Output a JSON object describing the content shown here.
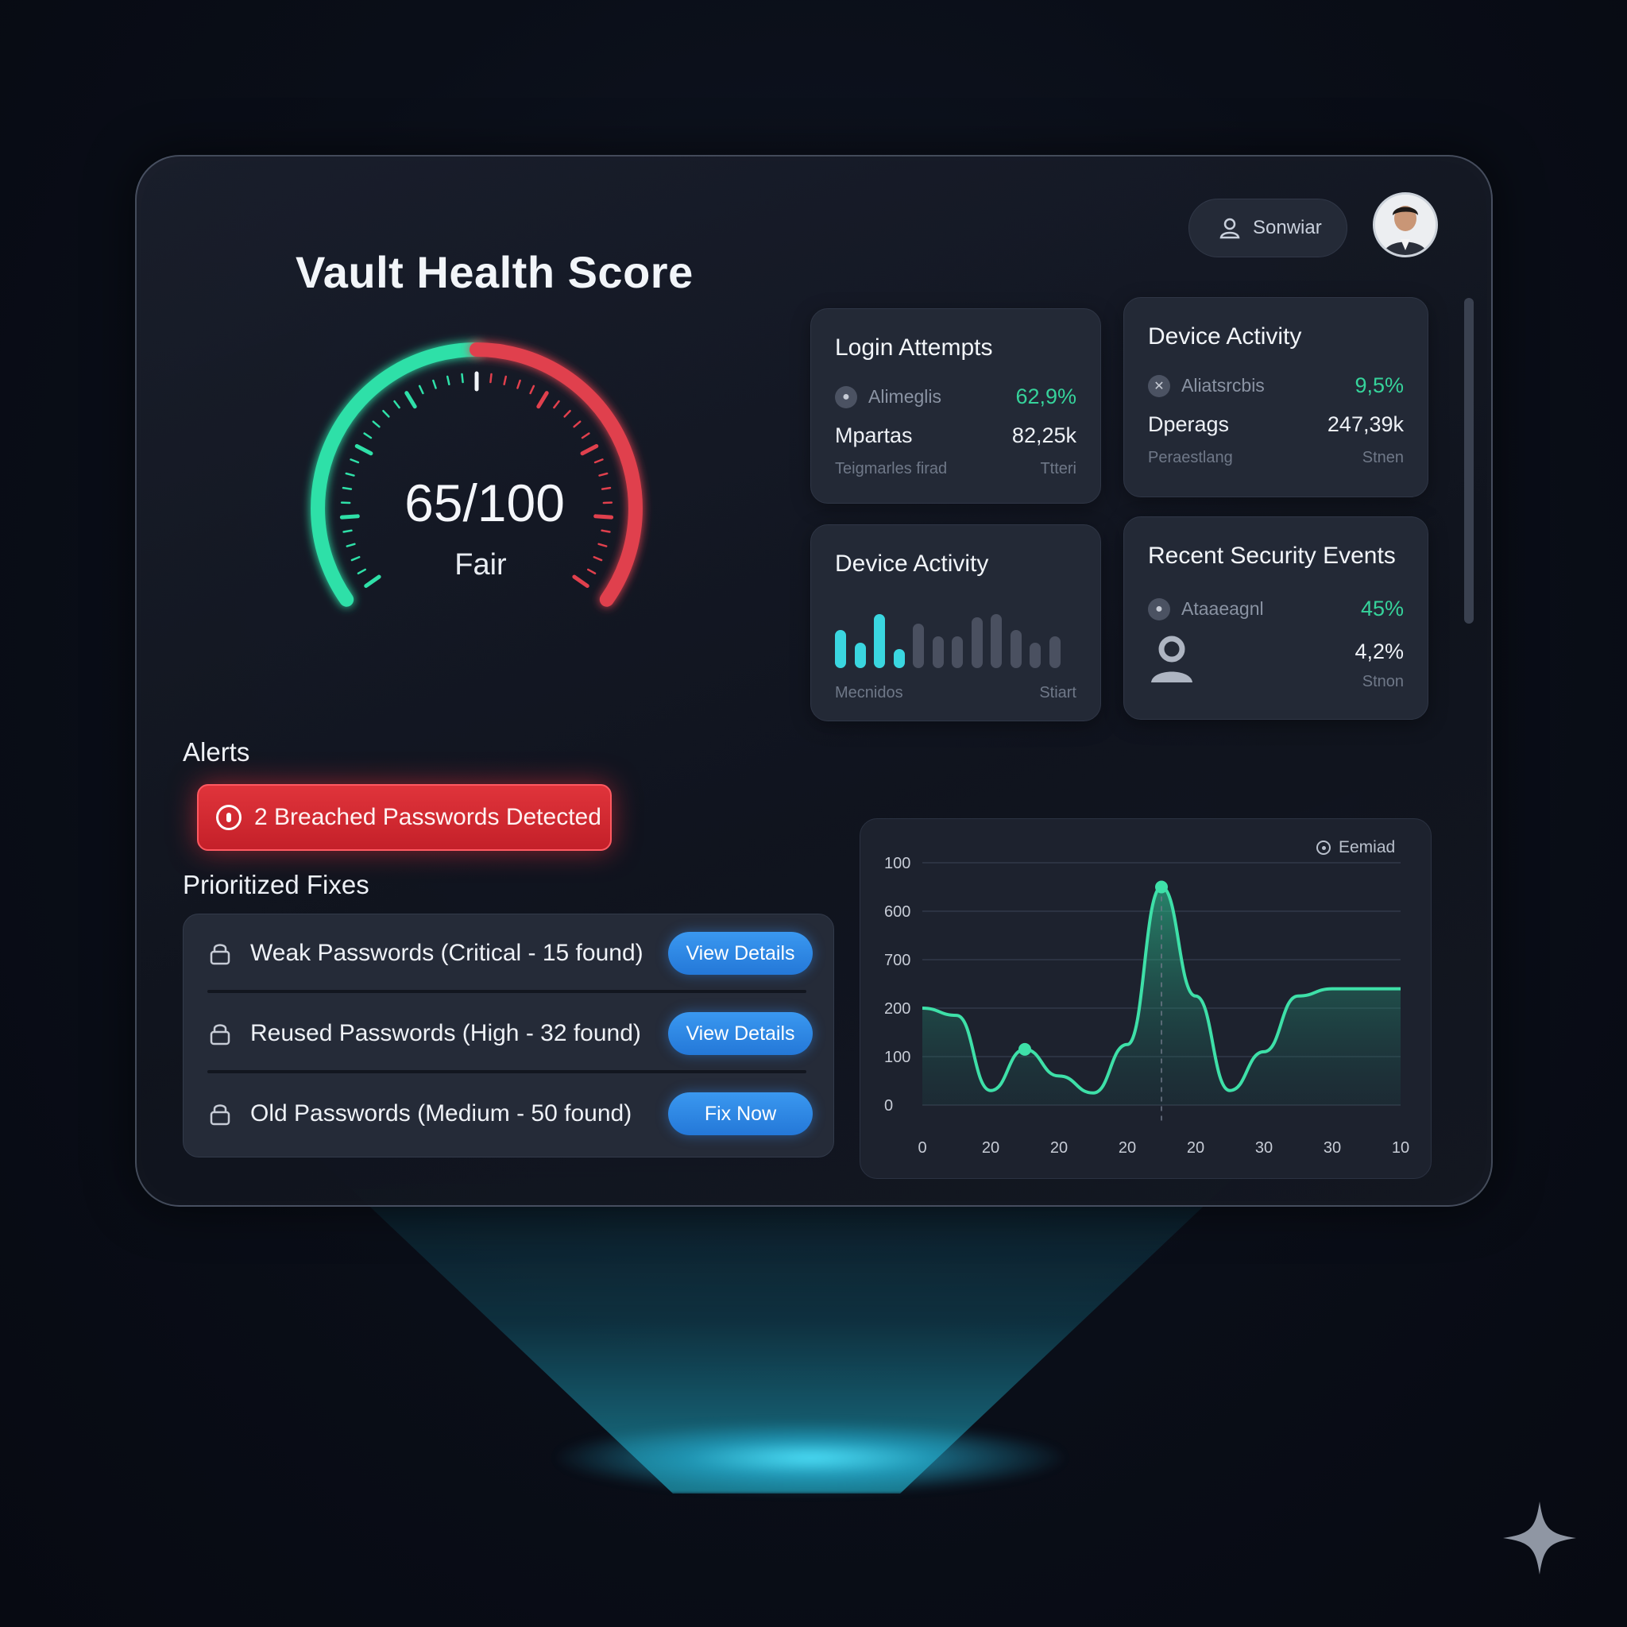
{
  "header": {
    "title": "Vault Health Score",
    "search_label": "Sonwiar",
    "avatar_icon": "user-avatar"
  },
  "gauge": {
    "value_text": "65/100",
    "status": "Fair",
    "score": 65,
    "max": 100,
    "colors": {
      "good": "#2fe0a8",
      "bad": "#e0404d"
    }
  },
  "cards": {
    "login": {
      "title": "Login Attempts",
      "row1": {
        "label": "Alimeglis",
        "value": "62,9%"
      },
      "row2": {
        "label": "Mpartas",
        "value": "82,25k"
      },
      "row3": {
        "label": "Teigmarles firad",
        "value": "Ttteri"
      }
    },
    "device_top": {
      "title": "Device Activity",
      "row1": {
        "label": "Aliatsrcbis",
        "value": "9,5%"
      },
      "row2": {
        "label": "Dperags",
        "value": "247,39k"
      },
      "row3": {
        "label": "Peraestlang",
        "value": "Stnen"
      }
    },
    "device_bars": {
      "title": "Device Activity",
      "footer_left": "Mecnidos",
      "footer_right": "Stiart",
      "bars": [
        0.6,
        0.4,
        0.85,
        0.3,
        0.7,
        0.5,
        0.5,
        0.8,
        0.85,
        0.6,
        0.4,
        0.5
      ]
    },
    "security": {
      "title": "Recent Security Events",
      "row1": {
        "label": "Ataaeagnl",
        "value": "45%"
      },
      "row2": {
        "value": "4,2%"
      },
      "row3": {
        "value": "Stnon"
      }
    }
  },
  "alerts": {
    "heading": "Alerts",
    "message": "2 Breached Passwords Detected"
  },
  "fixes": {
    "heading": "Prioritized Fixes",
    "items": [
      {
        "label": "Weak Passwords (Critical - 15 found)",
        "action": "View Details"
      },
      {
        "label": "Reused Passwords (High - 32 found)",
        "action": "View Details"
      },
      {
        "label": "Old Passwords (Medium - 50 found)",
        "action": "Fix Now"
      }
    ]
  },
  "chart_data": {
    "type": "area",
    "legend": "Eemiad",
    "y_tick_labels": [
      "100",
      "600",
      "700",
      "200",
      "100",
      "0"
    ],
    "x_tick_labels": [
      "0",
      "20",
      "20",
      "20",
      "20",
      "30",
      "30",
      "10"
    ],
    "x": [
      0,
      1,
      2,
      3,
      4,
      5,
      6,
      7,
      8,
      9,
      10,
      11,
      12,
      13,
      14
    ],
    "y": [
      0.4,
      0.37,
      0.06,
      0.23,
      0.12,
      0.05,
      0.25,
      0.9,
      0.45,
      0.06,
      0.22,
      0.45,
      0.48,
      0.48,
      0.48
    ],
    "highlight_points": [
      3,
      7
    ],
    "color": "#3ee0a8"
  }
}
